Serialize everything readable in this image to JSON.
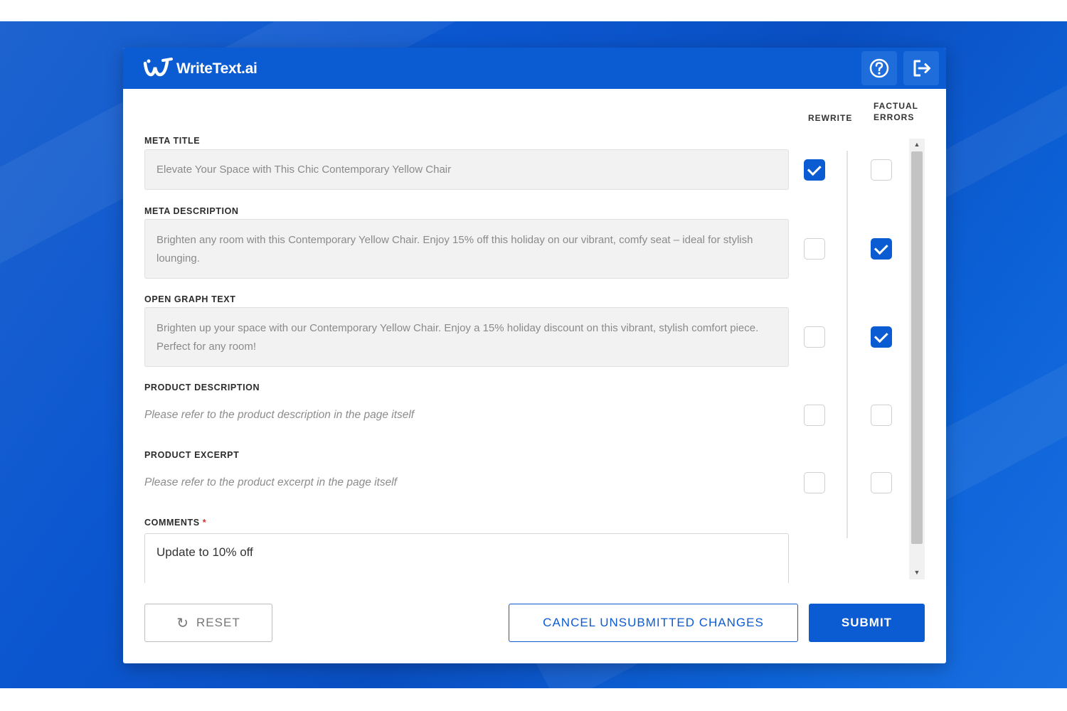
{
  "app": {
    "brand": "WriteText.ai"
  },
  "columns": {
    "rewrite": "REWRITE",
    "factual_line1": "FACTUAL",
    "factual_line2": "ERRORS"
  },
  "fields": {
    "meta_title": {
      "label": "META TITLE",
      "value": "Elevate Your Space with This Chic Contemporary Yellow Chair",
      "rewrite": true,
      "factual_errors": false
    },
    "meta_description": {
      "label": "META DESCRIPTION",
      "value": "Brighten any room with this Contemporary Yellow Chair. Enjoy 15% off this holiday on our vibrant, comfy seat – ideal for stylish lounging.",
      "rewrite": false,
      "factual_errors": true
    },
    "open_graph": {
      "label": "OPEN GRAPH TEXT",
      "value": "Brighten up your space with our Contemporary Yellow Chair. Enjoy a 15% holiday discount on this vibrant, stylish comfort piece. Perfect for any room!",
      "rewrite": false,
      "factual_errors": true
    },
    "product_description": {
      "label": "PRODUCT DESCRIPTION",
      "note": "Please refer to the product description in the page itself",
      "rewrite": false,
      "factual_errors": false
    },
    "product_excerpt": {
      "label": "PRODUCT EXCERPT",
      "note": "Please refer to the product excerpt in the page itself",
      "rewrite": false,
      "factual_errors": false
    },
    "comments": {
      "label": "COMMENTS",
      "required_marker": "*",
      "value": "Update to 10% off"
    }
  },
  "buttons": {
    "reset": "RESET",
    "cancel": "CANCEL UNSUBMITTED CHANGES",
    "submit": "SUBMIT"
  },
  "icons": {
    "logo": "writetext-logo-icon",
    "help": "help-circle-icon",
    "logout": "logout-icon",
    "reset": "refresh-icon"
  },
  "colors": {
    "accent": "#0b5bd3",
    "desktop": "#0a4fc2",
    "field_bg": "#f2f2f2",
    "required": "#d32f2f"
  }
}
